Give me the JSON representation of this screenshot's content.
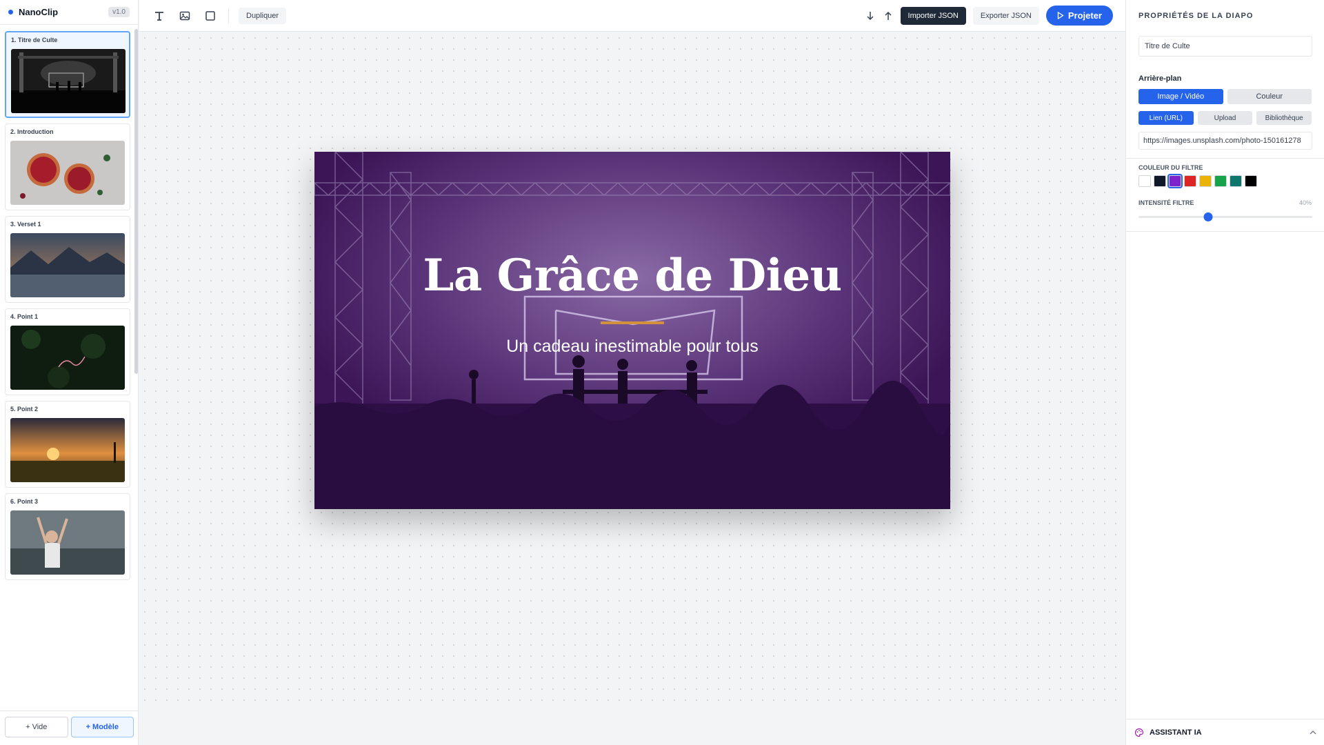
{
  "app": {
    "name": "NanoClip",
    "version": "v1.0"
  },
  "slides": [
    {
      "label": "1. Titre de Culte"
    },
    {
      "label": "2. Introduction"
    },
    {
      "label": "3. Verset 1"
    },
    {
      "label": "4. Point 1"
    },
    {
      "label": "5. Point 2"
    },
    {
      "label": "6. Point 3"
    }
  ],
  "sidebar_footer": {
    "empty_label": "+ Vide",
    "template_label": "+ Modèle"
  },
  "toolbar": {
    "duplicate_label": "Dupliquer",
    "import_label": "Importer JSON",
    "export_label": "Exporter JSON",
    "project_label": "Projeter",
    "icons": [
      "text-icon",
      "image-icon",
      "shape-icon",
      "arrow-down-icon",
      "arrow-up-icon",
      "play-icon"
    ]
  },
  "canvas_slide": {
    "title": "La Grâce de Dieu",
    "subtitle": "Un cadeau inestimable pour tous",
    "filter_color": "#3b1556",
    "accent_color": "#d4913b"
  },
  "panel": {
    "title": "PROPRIÉTÉS DE LA DIAPO",
    "slide_name": "Titre de Culte",
    "background_label": "Arrière-plan",
    "bg_type_options": [
      "Image / Vidéo",
      "Couleur"
    ],
    "bg_type_selected": "Image / Vidéo",
    "source_options": [
      "Lien (URL)",
      "Upload",
      "Bibliothèque"
    ],
    "source_selected": "Lien (URL)",
    "url_value": "https://images.unsplash.com/photo-150161278",
    "filter_color_label": "COULEUR DU FILTRE",
    "filter_colors": [
      "#ffffff",
      "#111827",
      "#7e22ce",
      "#dc2626",
      "#eab308",
      "#16a34a",
      "#0f766e",
      "#000000"
    ],
    "filter_color_selected": "#7e22ce",
    "filter_intensity_label": "INTENSITÉ FILTRE",
    "filter_intensity_value": "40%",
    "filter_intensity": 0.4,
    "assistant_label": "ASSISTANT IA"
  }
}
